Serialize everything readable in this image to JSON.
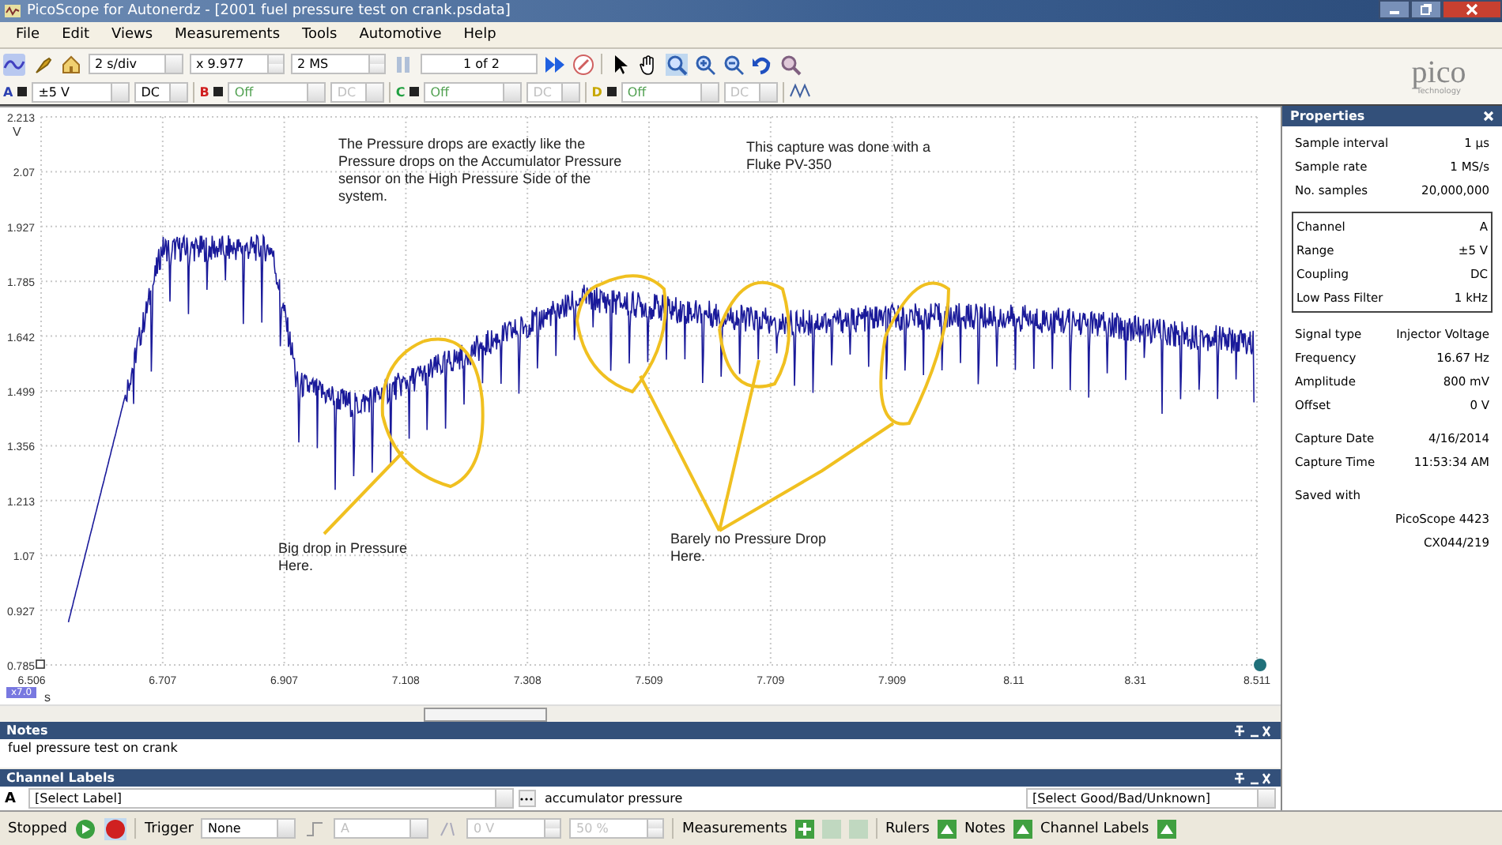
{
  "window": {
    "title": "PicoScope for Autonerdz - [2001 fuel pressure test on crank.psdata]"
  },
  "menu": [
    {
      "label": "File"
    },
    {
      "label": "Edit"
    },
    {
      "label": "Views"
    },
    {
      "label": "Measurements"
    },
    {
      "label": "Tools"
    },
    {
      "label": "Automotive"
    },
    {
      "label": "Help"
    }
  ],
  "toolbar": {
    "timebase": "2 s/div",
    "zoom": "x 9.977",
    "samples": "2 MS",
    "buffer": "1 of 2"
  },
  "logo": {
    "name": "pico",
    "tagline": "Technology"
  },
  "channels": [
    {
      "letter": "A",
      "color": "#2a3fb0",
      "range": "±5 V",
      "coupling": "DC",
      "disabled": false
    },
    {
      "letter": "B",
      "color": "#d02020",
      "range": "Off",
      "coupling": "DC",
      "disabled": true
    },
    {
      "letter": "C",
      "color": "#20a040",
      "range": "Off",
      "coupling": "DC",
      "disabled": true
    },
    {
      "letter": "D",
      "color": "#c8a800",
      "range": "Off",
      "coupling": "DC",
      "disabled": true
    }
  ],
  "scope": {
    "y_unit": "V",
    "x_unit": "s",
    "zoom_badge": "x7.0",
    "y_ticks": [
      "2.213",
      "2.07",
      "1.927",
      "1.785",
      "1.642",
      "1.499",
      "1.356",
      "1.213",
      "1.07",
      "0.927",
      "0.785"
    ],
    "x_ticks": [
      "6.506",
      "6.707",
      "6.907",
      "7.108",
      "7.308",
      "7.509",
      "7.709",
      "7.909",
      "8.11",
      "8.31",
      "8.511"
    ],
    "annotations": [
      "The Pressure drops are exactly like the Pressure drops on the Accumulator Pressure sensor on the High Pressure Side of the system.",
      "This capture was done with a Fluke PV-350",
      "Big drop in Pressure Here.",
      "Barely no Pressure Drop Here."
    ]
  },
  "notes": {
    "title": "Notes",
    "text": "fuel pressure test on crank"
  },
  "channel_labels": {
    "title": "Channel Labels",
    "channel": "A",
    "label_placeholder": "[Select Label]",
    "label_text": "accumulator pressure",
    "rating_placeholder": "[Select Good/Bad/Unknown]"
  },
  "properties": {
    "title": "Properties",
    "groups": [
      {
        "boxed": false,
        "rows": [
          [
            "Sample interval",
            "1 µs"
          ],
          [
            "Sample rate",
            "1 MS/s"
          ],
          [
            "No. samples",
            "20,000,000"
          ]
        ]
      },
      {
        "boxed": true,
        "rows": [
          [
            "Channel",
            "A"
          ],
          [
            "Range",
            "±5 V"
          ],
          [
            "Coupling",
            "DC"
          ],
          [
            "Low Pass Filter",
            "1 kHz"
          ]
        ]
      },
      {
        "boxed": false,
        "rows": [
          [
            "Signal type",
            "Injector Voltage"
          ],
          [
            "Frequency",
            "16.67 Hz"
          ],
          [
            "Amplitude",
            "800 mV"
          ],
          [
            "Offset",
            "0 V"
          ]
        ]
      },
      {
        "boxed": false,
        "rows": [
          [
            "Capture Date",
            "4/16/2014"
          ],
          [
            "Capture Time",
            "11:53:34 AM"
          ]
        ]
      },
      {
        "boxed": false,
        "rows": [
          [
            "Saved with",
            ""
          ],
          [
            "",
            "PicoScope 4423"
          ],
          [
            "",
            "CX044/219"
          ]
        ]
      }
    ]
  },
  "status": {
    "state": "Stopped",
    "trigger_label": "Trigger",
    "trigger_mode": "None",
    "trigger_channel": "A",
    "trigger_level": "0 V",
    "pre_trigger": "50 %",
    "panels": [
      "Measurements",
      "Rulers",
      "Notes",
      "Channel Labels"
    ]
  }
}
